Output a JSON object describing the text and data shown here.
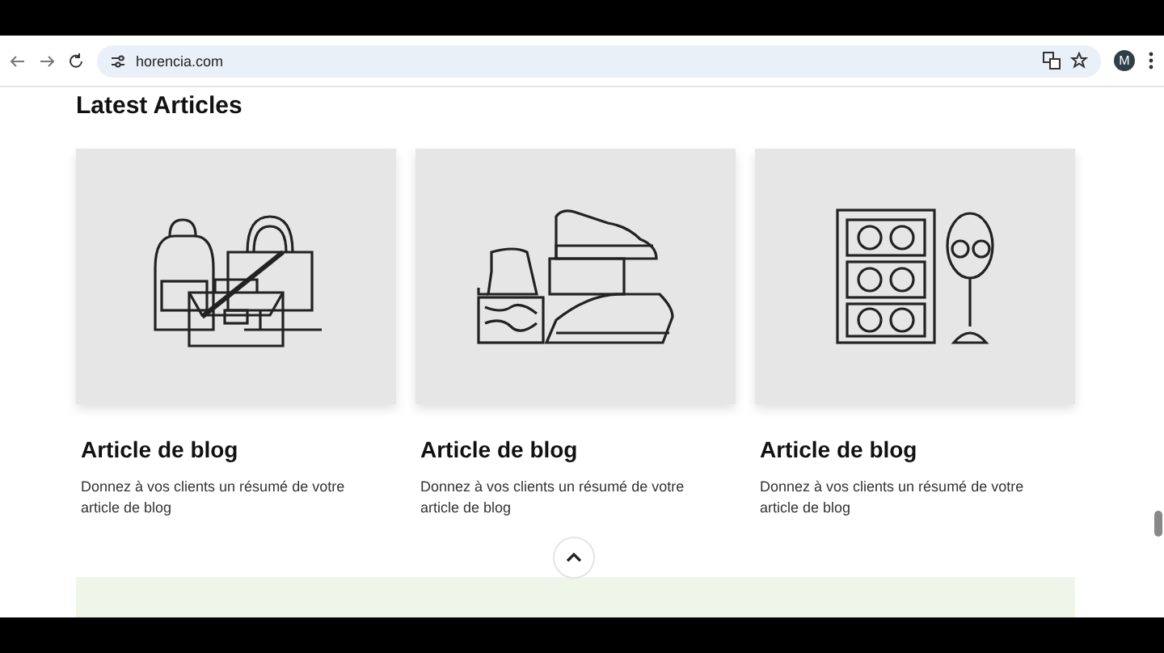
{
  "browser": {
    "url": "horencia.com",
    "profile_initial": "M"
  },
  "section": {
    "title": "Latest Articles"
  },
  "articles": [
    {
      "kind": "bags",
      "title": "Article de blog",
      "summary": "Donnez à vos clients un résumé de votre article de blog"
    },
    {
      "kind": "shoes",
      "title": "Article de blog",
      "summary": "Donnez à vos clients un résumé de votre article de blog"
    },
    {
      "kind": "glasses",
      "title": "Article de blog",
      "summary": "Donnez à vos clients un résumé de votre article de blog"
    }
  ]
}
